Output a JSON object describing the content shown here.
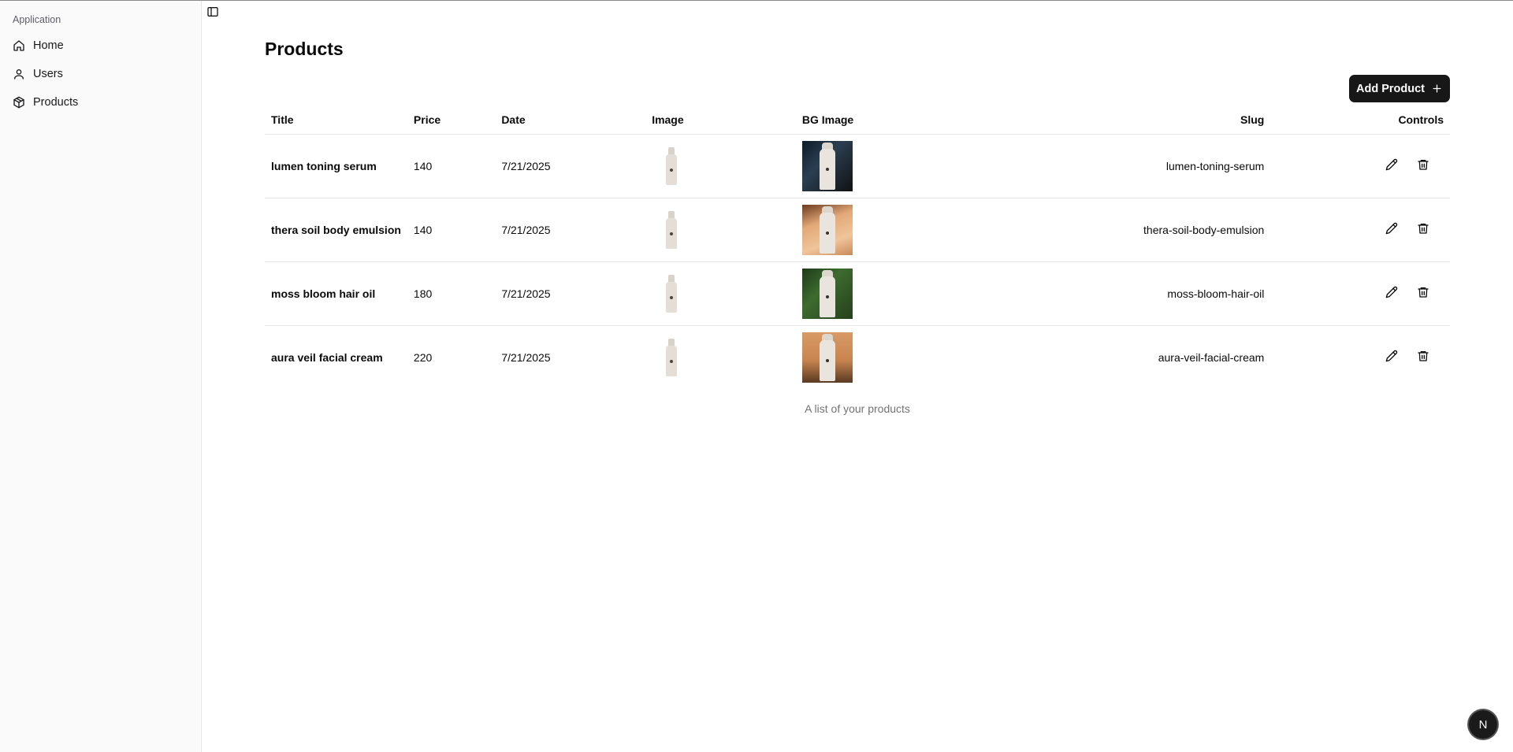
{
  "sidebar": {
    "group_label": "Application",
    "items": [
      {
        "label": "Home",
        "icon": "home-icon"
      },
      {
        "label": "Users",
        "icon": "user-icon"
      },
      {
        "label": "Products",
        "icon": "package-icon"
      }
    ]
  },
  "header": {
    "title": "Products",
    "add_button_label": "Add Product"
  },
  "table": {
    "columns": [
      "Title",
      "Price",
      "Date",
      "Image",
      "BG Image",
      "Slug",
      "Controls"
    ],
    "rows": [
      {
        "title": "lumen toning serum",
        "price": "140",
        "date": "7/21/2025",
        "slug": "lumen-toning-serum"
      },
      {
        "title": "thera soil body emulsion",
        "price": "140",
        "date": "7/21/2025",
        "slug": "thera-soil-body-emulsion"
      },
      {
        "title": "moss bloom hair oil",
        "price": "180",
        "date": "7/21/2025",
        "slug": "moss-bloom-hair-oil"
      },
      {
        "title": "aura veil facial cream",
        "price": "220",
        "date": "7/21/2025",
        "slug": "aura-veil-facial-cream"
      }
    ],
    "caption": "A list of your products"
  },
  "badge": {
    "label": "N"
  },
  "colors": {
    "button_bg": "#171717",
    "sidebar_bg": "#fafafa",
    "border": "#e5e5e5"
  }
}
